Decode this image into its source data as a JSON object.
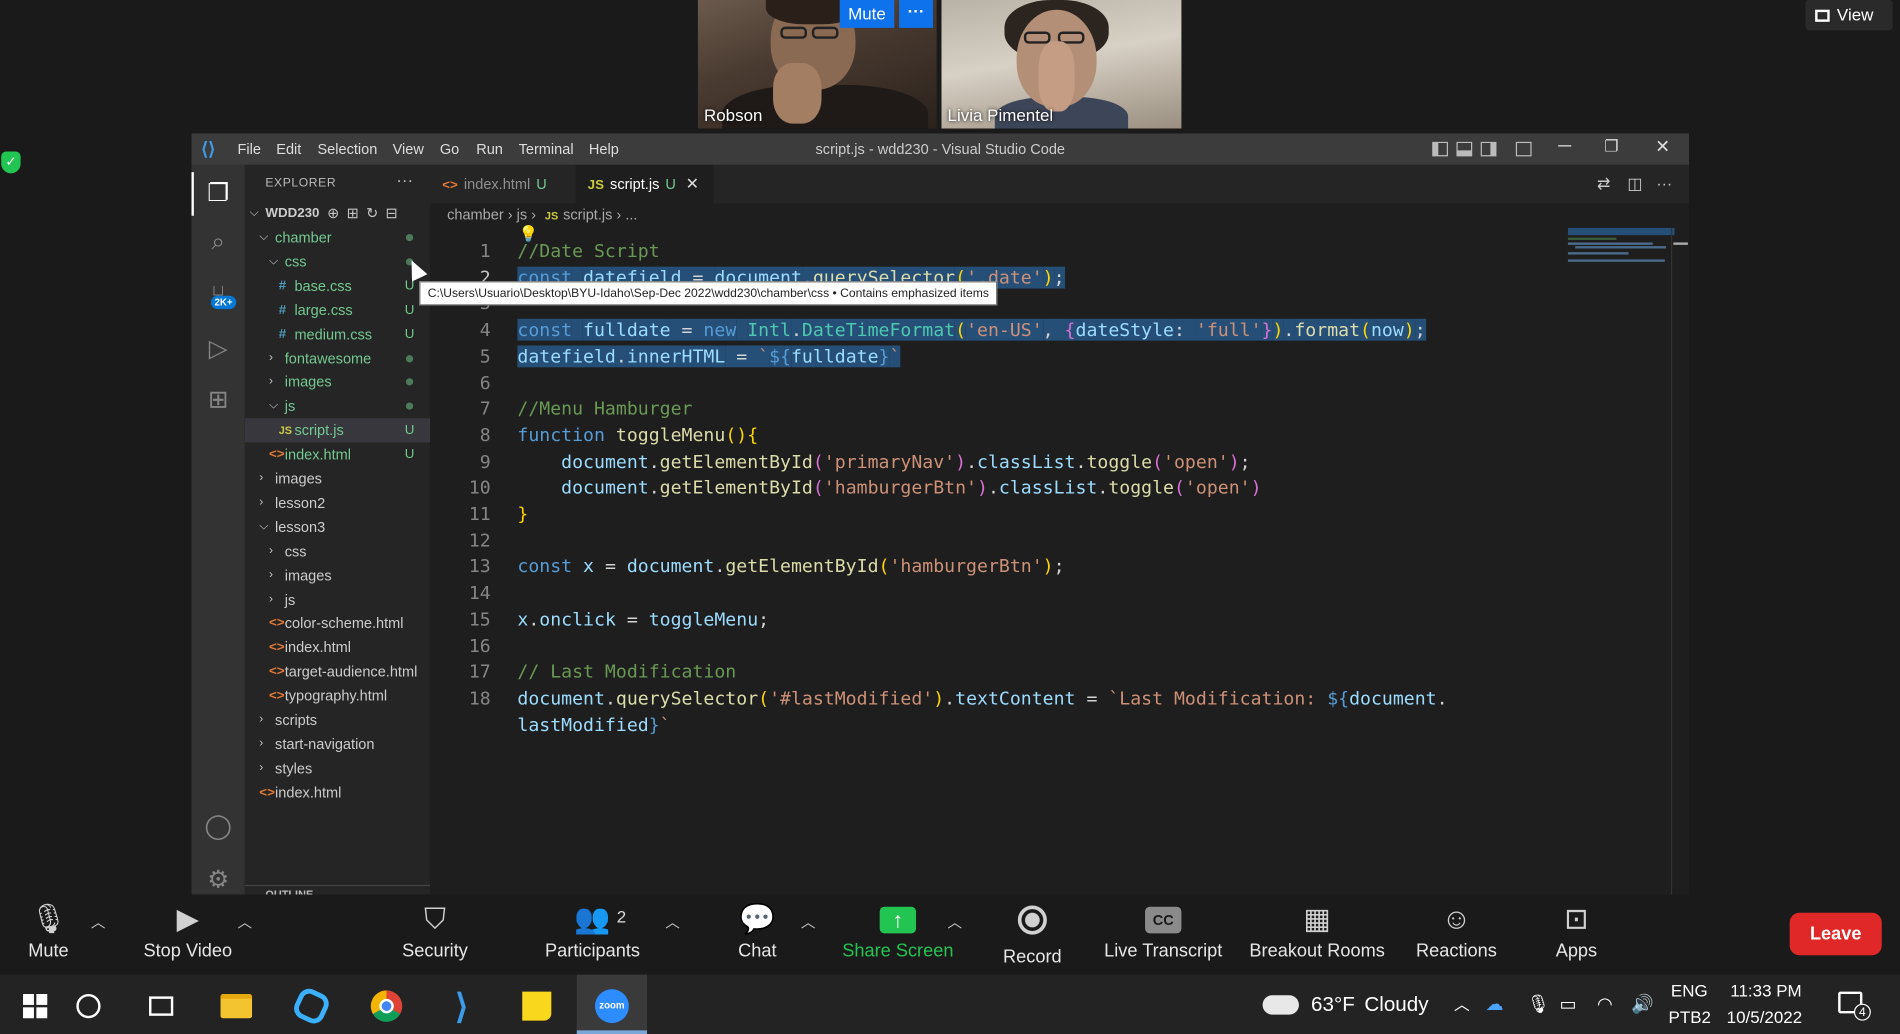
{
  "zoom": {
    "participants": [
      {
        "name": "Robson"
      },
      {
        "name": "Livia Pimentel"
      }
    ],
    "tile_controls": {
      "mute_label": "Mute",
      "more_label": "···"
    },
    "view_label": "View",
    "toolbar": {
      "mute": "Mute",
      "stop_video": "Stop Video",
      "security": "Security",
      "participants": "Participants",
      "participants_count": "2",
      "chat": "Chat",
      "share_screen": "Share Screen",
      "record": "Record",
      "live_transcript": "Live Transcript",
      "live_transcript_icon_text": "CC",
      "breakout_rooms": "Breakout Rooms",
      "reactions": "Reactions",
      "apps": "Apps",
      "leave": "Leave"
    },
    "colors": {
      "share_green": "#23c552",
      "leave_red": "#e02828",
      "accent_blue": "#0e72ed"
    }
  },
  "vscode": {
    "menu": [
      "File",
      "Edit",
      "Selection",
      "View",
      "Go",
      "Run",
      "Terminal",
      "Help"
    ],
    "window_title": "script.js - wdd230 - Visual Studio Code",
    "explorer_title": "EXPLORER",
    "explorer_more": "···",
    "root_folder": "WDD230",
    "tree": [
      {
        "label": "chamber",
        "type": "folder",
        "open": true,
        "indent": 1,
        "modified": true
      },
      {
        "label": "css",
        "type": "folder",
        "open": true,
        "indent": 2,
        "modified": true
      },
      {
        "label": "base.css",
        "type": "css",
        "indent": 3,
        "status": "U"
      },
      {
        "label": "large.css",
        "type": "css",
        "indent": 3,
        "status": "U"
      },
      {
        "label": "medium.css",
        "type": "css",
        "indent": 3,
        "status": "U"
      },
      {
        "label": "fontawesome",
        "type": "folder",
        "open": false,
        "indent": 2,
        "modified": true
      },
      {
        "label": "images",
        "type": "folder",
        "open": false,
        "indent": 2,
        "modified": true
      },
      {
        "label": "js",
        "type": "folder",
        "open": true,
        "indent": 2,
        "modified": true
      },
      {
        "label": "script.js",
        "type": "js",
        "indent": 3,
        "status": "U",
        "selected": true
      },
      {
        "label": "index.html",
        "type": "html",
        "indent": 2,
        "status": "U"
      },
      {
        "label": "images",
        "type": "folder",
        "open": false,
        "indent": 1
      },
      {
        "label": "lesson2",
        "type": "folder",
        "open": false,
        "indent": 1
      },
      {
        "label": "lesson3",
        "type": "folder",
        "open": true,
        "indent": 1
      },
      {
        "label": "css",
        "type": "folder",
        "open": false,
        "indent": 2
      },
      {
        "label": "images",
        "type": "folder",
        "open": false,
        "indent": 2
      },
      {
        "label": "js",
        "type": "folder",
        "open": false,
        "indent": 2
      },
      {
        "label": "color-scheme.html",
        "type": "html",
        "indent": 2
      },
      {
        "label": "index.html",
        "type": "html",
        "indent": 2
      },
      {
        "label": "target-audience.html",
        "type": "html",
        "indent": 2
      },
      {
        "label": "typography.html",
        "type": "html",
        "indent": 2
      },
      {
        "label": "scripts",
        "type": "folder",
        "open": false,
        "indent": 1
      },
      {
        "label": "start-navigation",
        "type": "folder",
        "open": false,
        "indent": 1
      },
      {
        "label": "styles",
        "type": "folder",
        "open": false,
        "indent": 1
      },
      {
        "label": "index.html",
        "type": "html",
        "indent": 1
      }
    ],
    "outline_label": "OUTLINE",
    "activity_badge": "2K+",
    "tabs": [
      {
        "label": "index.html",
        "status": "U",
        "icon": "<>",
        "active": false
      },
      {
        "label": "script.js",
        "status": "U",
        "icon": "JS",
        "active": true
      }
    ],
    "breadcrumb": [
      "chamber",
      "js",
      "script.js",
      "..."
    ],
    "tooltip": "C:\\Users\\Usuario\\Desktop\\BYU-Idaho\\Sep-Dec 2022\\wdd230\\chamber\\css • Contains emphasized items",
    "current_line": 2,
    "code": [
      {
        "n": 1,
        "tokens": [
          [
            "cmt",
            "//Date Script"
          ]
        ]
      },
      {
        "n": 2,
        "sel": true,
        "tokens": [
          [
            "kw",
            "const"
          ],
          [
            "",
            " "
          ],
          [
            "var",
            "datefield"
          ],
          [
            "",
            " = "
          ],
          [
            "var",
            "document"
          ],
          [
            "",
            "."
          ],
          [
            "fn",
            "querySelector"
          ],
          [
            "br1",
            "("
          ],
          [
            "str",
            "'.date'"
          ],
          [
            "br1",
            ")"
          ],
          [
            "",
            ";"
          ]
        ]
      },
      {
        "n": 3,
        "sel": true,
        "tokens": []
      },
      {
        "n": 4,
        "sel": true,
        "tokens": [
          [
            "kw",
            "const"
          ],
          [
            "",
            " "
          ],
          [
            "var",
            "fulldate"
          ],
          [
            "",
            " = "
          ],
          [
            "kw",
            "new"
          ],
          [
            "",
            " "
          ],
          [
            "cls",
            "Intl"
          ],
          [
            "",
            "."
          ],
          [
            "cls",
            "DateTimeFormat"
          ],
          [
            "br1",
            "("
          ],
          [
            "str",
            "'en-US'"
          ],
          [
            "",
            ", "
          ],
          [
            "br2",
            "{"
          ],
          [
            "var",
            "dateStyle"
          ],
          [
            "",
            ": "
          ],
          [
            "str",
            "'full'"
          ],
          [
            "br2",
            "}"
          ],
          [
            "br1",
            ")"
          ],
          [
            "",
            "."
          ],
          [
            "fn",
            "format"
          ],
          [
            "br1",
            "("
          ],
          [
            "var",
            "now"
          ],
          [
            "br1",
            ")"
          ],
          [
            "",
            ";"
          ]
        ]
      },
      {
        "n": 5,
        "sel": true,
        "tokens": [
          [
            "var",
            "datefield"
          ],
          [
            "",
            "."
          ],
          [
            "var",
            "innerHTML"
          ],
          [
            "",
            " = "
          ],
          [
            "str",
            "`"
          ],
          [
            "kw",
            "${"
          ],
          [
            "var",
            "fulldate"
          ],
          [
            "kw",
            "}"
          ],
          [
            "str",
            "`"
          ]
        ]
      },
      {
        "n": 6,
        "tokens": []
      },
      {
        "n": 7,
        "tokens": [
          [
            "cmt",
            "//Menu Hamburger"
          ]
        ]
      },
      {
        "n": 8,
        "tokens": [
          [
            "kw",
            "function"
          ],
          [
            "",
            " "
          ],
          [
            "fn",
            "toggleMenu"
          ],
          [
            "br1",
            "()"
          ],
          [
            "br1",
            "{"
          ]
        ]
      },
      {
        "n": 9,
        "tokens": [
          [
            "",
            "    "
          ],
          [
            "var",
            "document"
          ],
          [
            "",
            "."
          ],
          [
            "fn",
            "getElementById"
          ],
          [
            "br2",
            "("
          ],
          [
            "str",
            "'primaryNav'"
          ],
          [
            "br2",
            ")"
          ],
          [
            "",
            "."
          ],
          [
            "var",
            "classList"
          ],
          [
            "",
            "."
          ],
          [
            "fn",
            "toggle"
          ],
          [
            "br2",
            "("
          ],
          [
            "str",
            "'open'"
          ],
          [
            "br2",
            ")"
          ],
          [
            "",
            ";"
          ]
        ]
      },
      {
        "n": 10,
        "tokens": [
          [
            "",
            "    "
          ],
          [
            "var",
            "document"
          ],
          [
            "",
            "."
          ],
          [
            "fn",
            "getElementById"
          ],
          [
            "br2",
            "("
          ],
          [
            "str",
            "'hamburgerBtn'"
          ],
          [
            "br2",
            ")"
          ],
          [
            "",
            "."
          ],
          [
            "var",
            "classList"
          ],
          [
            "",
            "."
          ],
          [
            "fn",
            "toggle"
          ],
          [
            "br2",
            "("
          ],
          [
            "str",
            "'open'"
          ],
          [
            "br2",
            ")"
          ]
        ]
      },
      {
        "n": 11,
        "tokens": [
          [
            "br1",
            "}"
          ]
        ]
      },
      {
        "n": 12,
        "tokens": []
      },
      {
        "n": 13,
        "tokens": [
          [
            "kw",
            "const"
          ],
          [
            "",
            " "
          ],
          [
            "var",
            "x"
          ],
          [
            "",
            " = "
          ],
          [
            "var",
            "document"
          ],
          [
            "",
            "."
          ],
          [
            "fn",
            "getElementById"
          ],
          [
            "br1",
            "("
          ],
          [
            "str",
            "'hamburgerBtn'"
          ],
          [
            "br1",
            ")"
          ],
          [
            "",
            ";"
          ]
        ]
      },
      {
        "n": 14,
        "tokens": []
      },
      {
        "n": 15,
        "tokens": [
          [
            "var",
            "x"
          ],
          [
            "",
            "."
          ],
          [
            "var",
            "onclick"
          ],
          [
            "",
            " = "
          ],
          [
            "var",
            "toggleMenu"
          ],
          [
            "",
            ";"
          ]
        ]
      },
      {
        "n": 16,
        "tokens": []
      },
      {
        "n": 17,
        "tokens": [
          [
            "cmt",
            "// Last Modification"
          ]
        ]
      },
      {
        "n": 18,
        "tokens": [
          [
            "var",
            "document"
          ],
          [
            "",
            "."
          ],
          [
            "fn",
            "querySelector"
          ],
          [
            "br1",
            "("
          ],
          [
            "str",
            "'#lastModified'"
          ],
          [
            "br1",
            ")"
          ],
          [
            "",
            "."
          ],
          [
            "var",
            "textContent"
          ],
          [
            "",
            " = "
          ],
          [
            "str",
            "`Last Modification: "
          ],
          [
            "kw",
            "${"
          ],
          [
            "var",
            "document"
          ],
          [
            "",
            "."
          ]
        ]
      },
      {
        "n": null,
        "tokens": [
          [
            "var",
            "lastModified"
          ],
          [
            "kw",
            "}"
          ],
          [
            "str",
            "`"
          ]
        ]
      }
    ]
  },
  "taskbar": {
    "weather_temp": "63°F",
    "weather_text": "Cloudy",
    "lang_top": "ENG",
    "lang_bottom": "PTB2",
    "time": "11:33 PM",
    "date": "10/5/2022",
    "notification_count": "4",
    "apps": [
      "windows-start",
      "search",
      "task-view",
      "file-explorer",
      "swirl-app",
      "chrome",
      "vscode",
      "sticky-notes",
      "zoom"
    ]
  }
}
